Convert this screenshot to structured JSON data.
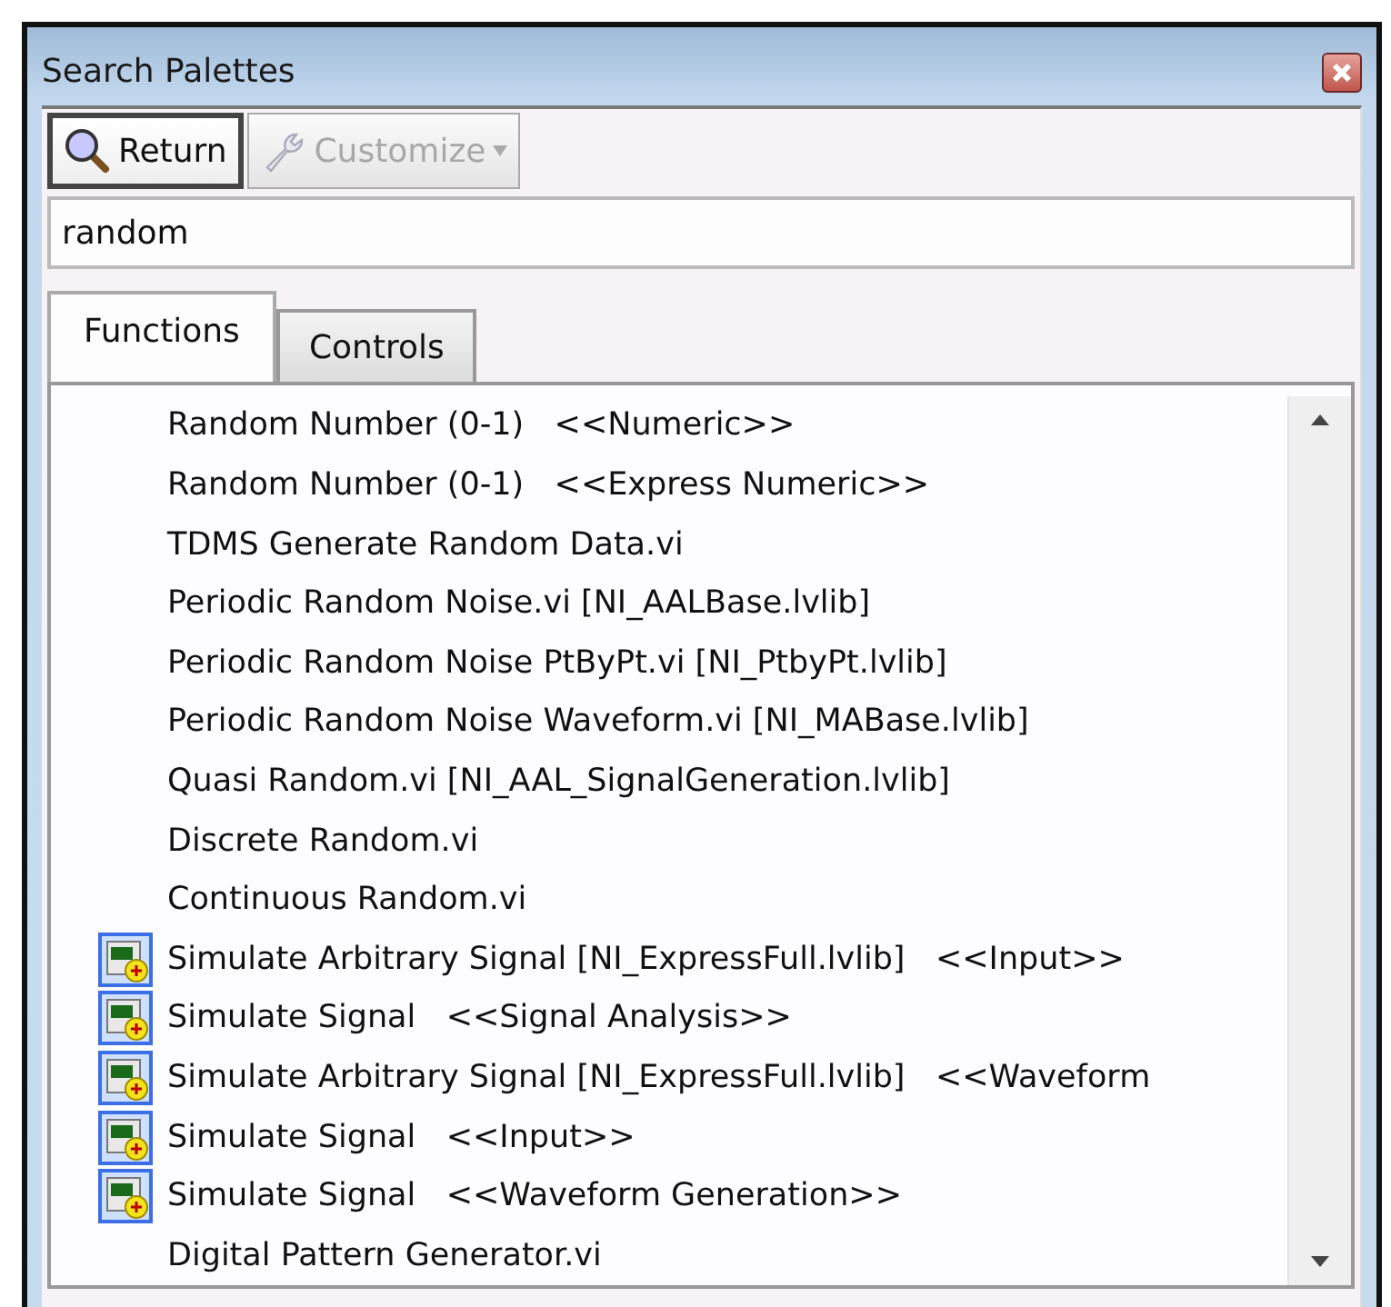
{
  "window": {
    "title": "Search Palettes"
  },
  "toolbar": [
    {
      "label": "Return",
      "kind": "return",
      "disabled": false
    },
    {
      "label": "Customize",
      "kind": "customize",
      "disabled": true
    }
  ],
  "search": {
    "value": "random"
  },
  "tabs": [
    {
      "label": "Functions",
      "selected": true
    },
    {
      "label": "Controls",
      "selected": false
    }
  ],
  "results": [
    {
      "text": "Random Number (0-1)   <<Numeric>>",
      "kind": "plain"
    },
    {
      "text": "Random Number (0-1)   <<Express Numeric>>",
      "kind": "plain"
    },
    {
      "text": "TDMS Generate Random Data.vi",
      "kind": "plain"
    },
    {
      "text": "Periodic Random Noise.vi [NI_AALBase.lvlib]",
      "kind": "plain"
    },
    {
      "text": "Periodic Random Noise PtByPt.vi [NI_PtbyPt.lvlib]",
      "kind": "plain"
    },
    {
      "text": "Periodic Random Noise Waveform.vi [NI_MABase.lvlib]",
      "kind": "plain"
    },
    {
      "text": "Quasi Random.vi [NI_AAL_SignalGeneration.lvlib]",
      "kind": "plain"
    },
    {
      "text": "Discrete Random.vi",
      "kind": "plain"
    },
    {
      "text": "Continuous Random.vi",
      "kind": "plain"
    },
    {
      "text": "Simulate Arbitrary Signal [NI_ExpressFull.lvlib]   <<Input>>",
      "kind": "express"
    },
    {
      "text": "Simulate Signal   <<Signal Analysis>>",
      "kind": "express"
    },
    {
      "text": "Simulate Arbitrary Signal [NI_ExpressFull.lvlib]   <<Waveform",
      "kind": "express"
    },
    {
      "text": "Simulate Signal   <<Input>>",
      "kind": "express"
    },
    {
      "text": "Simulate Signal   <<Waveform Generation>>",
      "kind": "express"
    },
    {
      "text": "Digital Pattern Generator.vi",
      "kind": "plain"
    }
  ]
}
